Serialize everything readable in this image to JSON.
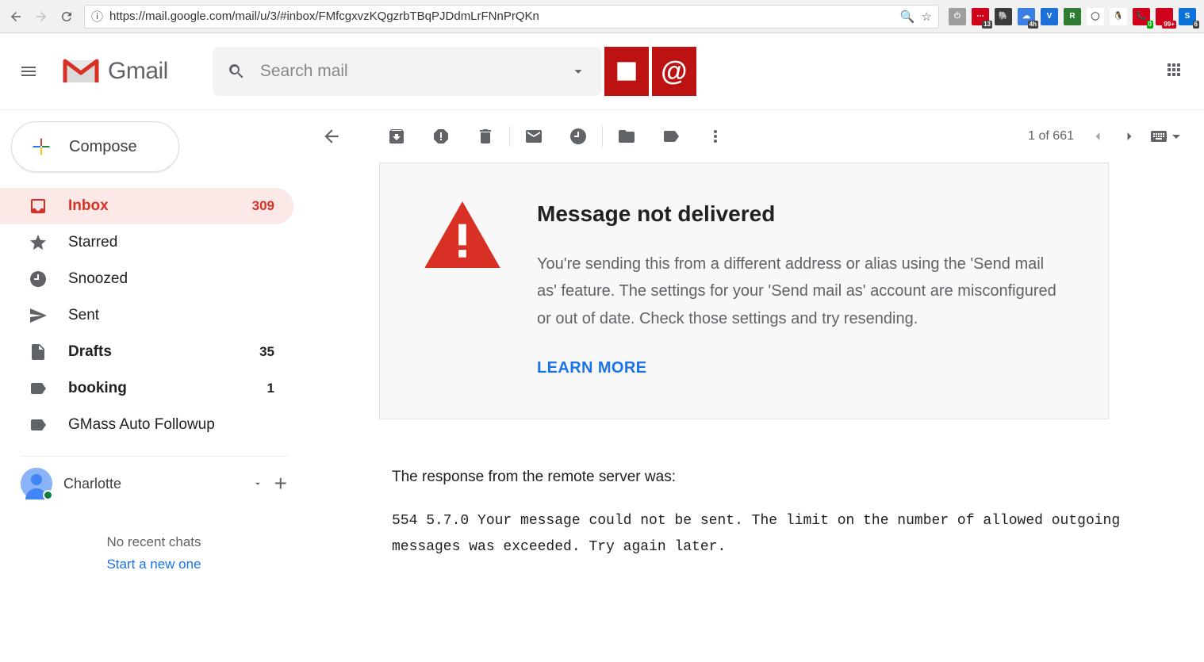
{
  "browser": {
    "url": "https://mail.google.com/mail/u/3/#inbox/FMfcgxvzKQgzrbTBqPJDdmLrFNnPrQKn",
    "ext_icons": [
      {
        "bg": "#9e9e9e",
        "txt": "⏻"
      },
      {
        "bg": "#d0021b",
        "txt": "⋯",
        "badge": "13"
      },
      {
        "bg": "#3a3a3a",
        "txt": "🐘"
      },
      {
        "bg": "#3b7fe4",
        "txt": "☁",
        "badge": "4h"
      },
      {
        "bg": "#1d6fd8",
        "txt": "V"
      },
      {
        "bg": "#2e7d32",
        "txt": "R"
      },
      {
        "bg": "#ffffff",
        "txt": "◯"
      },
      {
        "bg": "#ffffff",
        "txt": "🐧"
      },
      {
        "bg": "#d0021b",
        "txt": "📞",
        "badge": "0",
        "badge_class": "green"
      },
      {
        "bg": "#d0021b",
        "txt": "",
        "badge": "99+",
        "badge_class": "red"
      },
      {
        "bg": "#0b72d9",
        "txt": "S",
        "badge": "6"
      }
    ]
  },
  "header": {
    "product": "Gmail",
    "search_placeholder": "Search mail"
  },
  "sidebar": {
    "compose": "Compose",
    "items": [
      {
        "icon": "inbox",
        "label": "Inbox",
        "count": "309",
        "active": true,
        "bold": true
      },
      {
        "icon": "star",
        "label": "Starred"
      },
      {
        "icon": "clock",
        "label": "Snoozed"
      },
      {
        "icon": "send",
        "label": "Sent"
      },
      {
        "icon": "file",
        "label": "Drafts",
        "count": "35",
        "bold": true
      },
      {
        "icon": "label",
        "label": "booking",
        "count": "1",
        "bold": true
      },
      {
        "icon": "label",
        "label": "GMass Auto Followup"
      }
    ],
    "hangouts": {
      "name": "Charlotte",
      "empty1": "No recent chats",
      "empty2": "Start a new one"
    }
  },
  "toolbar": {
    "count": "1 of 661"
  },
  "message": {
    "title": "Message not delivered",
    "body": "You're sending this from a different address or alias using the 'Send mail as' feature. The settings for your 'Send mail as' account are misconfigured or out of date. Check those settings and try resending.",
    "learn_more": "LEARN MORE"
  },
  "response": {
    "label": "The response from the remote server was:",
    "code": "554 5.7.0 Your message could not be sent. The limit on the number of allowed outgoing messages was exceeded. Try again later."
  }
}
